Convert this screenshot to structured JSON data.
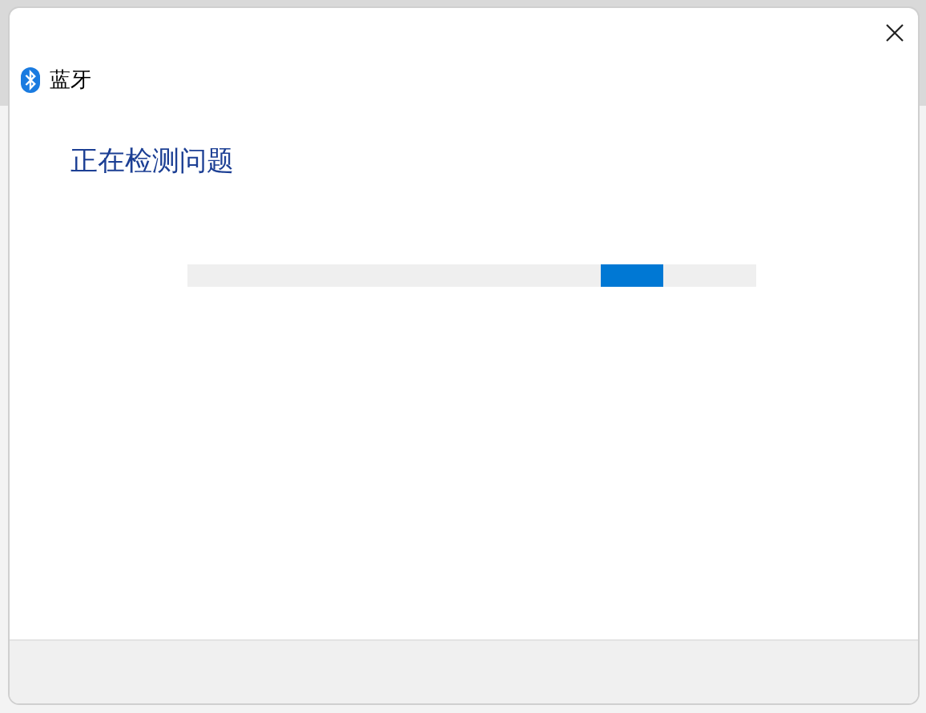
{
  "window": {
    "title": "蓝牙"
  },
  "heading": "正在检测问题",
  "progress": {
    "kind": "indeterminate"
  }
}
